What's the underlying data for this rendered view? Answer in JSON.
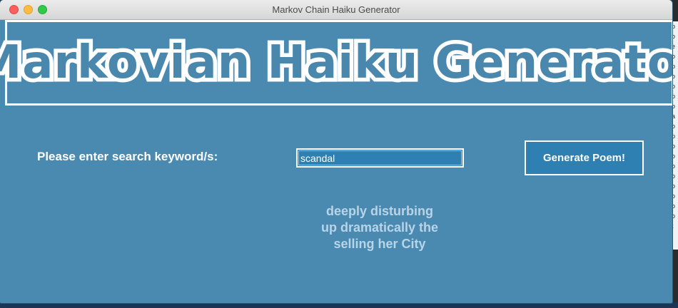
{
  "window": {
    "title": "Markov Chain Haiku Generator"
  },
  "banner": {
    "title": "Markovian Haiku Generator"
  },
  "form": {
    "prompt_label": "Please enter search keyword/s:",
    "keyword_value": "scandal",
    "generate_label": "Generate Poem!"
  },
  "poem": {
    "lines": [
      "deeply disturbing",
      "up dramatically the",
      "selling her City"
    ]
  },
  "background": {
    "side_text": [
      "p",
      "o",
      "e",
      "o",
      "p",
      "o",
      "o",
      "p",
      "o",
      "a",
      "o",
      "p",
      "o",
      "o",
      "o",
      "o",
      "o",
      "o",
      "o",
      "o",
      "t"
    ]
  },
  "colors": {
    "window_bg": "#4a8ab0",
    "input_bg": "#2e7fb2",
    "poem_text": "#b8d4e8",
    "banner_text": "#4a87ad"
  }
}
